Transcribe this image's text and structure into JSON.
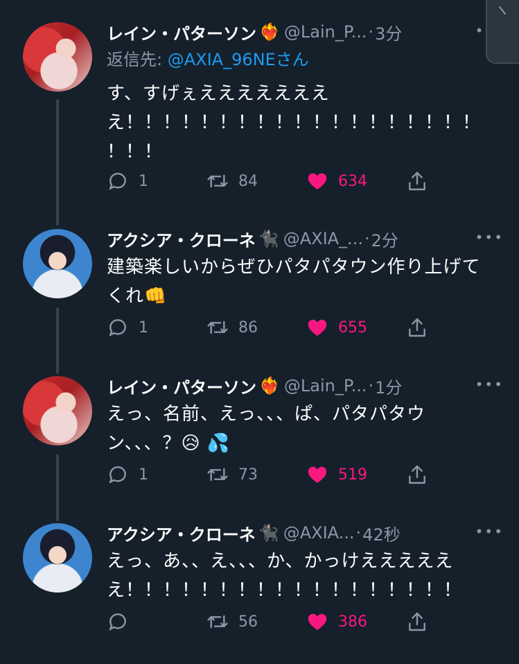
{
  "tweets": [
    {
      "name": "レイン・パターソン",
      "name_emoji": "❤️‍🔥",
      "handle": "@Lain_P...",
      "time": "3分",
      "reply_prefix": "返信先: ",
      "reply_mention": "@AXIA_96NE",
      "reply_suffix": "さん",
      "lines": [
        "す、すげぇえええええええ",
        "え！！！！！！！！！！！！！！！！！！！",
        "！！！"
      ],
      "replies": "1",
      "retweets": "84",
      "likes": "634",
      "avatar": "red"
    },
    {
      "name": "アクシア・クローネ",
      "name_emoji": "🐈‍⬛",
      "handle": "@AXIA_...",
      "time": "2分",
      "lines": [
        "建築楽しいからぜひパタパタウン作り上げて",
        "くれ👊"
      ],
      "replies": "1",
      "retweets": "86",
      "likes": "655",
      "avatar": "blue"
    },
    {
      "name": "レイン・パターソン",
      "name_emoji": "❤️‍🔥",
      "handle": "@Lain_P...",
      "time": "1分",
      "lines": [
        "えっ、名前、えっ、、、ぱ、パタパタウ",
        "ン、、、？😥 💦"
      ],
      "replies": "1",
      "retweets": "73",
      "likes": "519",
      "avatar": "red"
    },
    {
      "name": "アクシア・クローネ",
      "name_emoji": "🐈‍⬛",
      "handle": "@AXIA...",
      "time": "42秒",
      "lines": [
        "えっ、あ、、え、、、か、かっけえええええ",
        "え！！！！！！！！！！！！！！！！！！"
      ],
      "replies": "",
      "retweets": "56",
      "likes": "386",
      "avatar": "blue"
    }
  ],
  "separator": "·",
  "more_label": "•••",
  "icons": {
    "reply": "speech-bubble-icon",
    "retweet": "retweet-icon",
    "like": "heart-icon",
    "share": "share-icon",
    "chevron": "chevron-down-icon"
  },
  "colors": {
    "background": "#15202b",
    "muted": "#8b98a5",
    "mention": "#1d9bf0",
    "like": "#f91880"
  }
}
